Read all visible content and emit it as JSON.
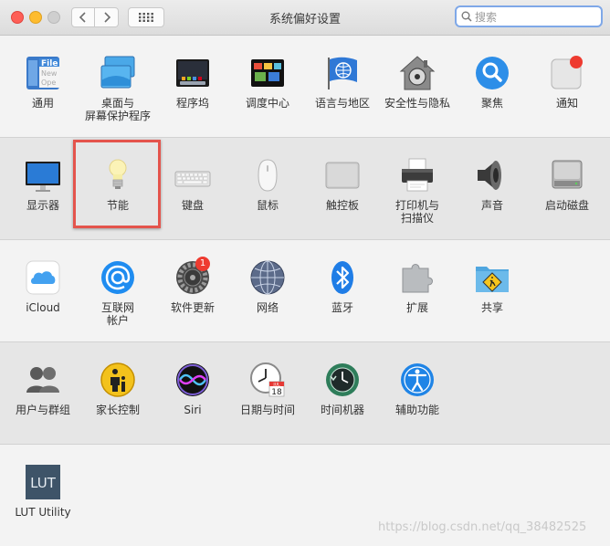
{
  "window": {
    "title": "系统偏好设置"
  },
  "search": {
    "placeholder": "搜索"
  },
  "row1": {
    "general": "通用",
    "desktop": "桌面与\n屏幕保护程序",
    "dock": "程序坞",
    "mission_control": "调度中心",
    "language": "语言与地区",
    "security": "安全性与隐私",
    "spotlight": "聚焦",
    "notifications": "通知",
    "general_icon_text": [
      "File",
      "New",
      "Ope"
    ]
  },
  "row2": {
    "displays": "显示器",
    "energy": "节能",
    "keyboard": "键盘",
    "mouse": "鼠标",
    "trackpad": "触控板",
    "printers": "打印机与\n扫描仪",
    "sound": "声音",
    "startup": "启动磁盘"
  },
  "row3": {
    "icloud": "iCloud",
    "internet_accounts": "互联网\n帐户",
    "software_update": "软件更新",
    "software_update_badge": "1",
    "network": "网络",
    "bluetooth": "蓝牙",
    "extensions": "扩展",
    "sharing": "共享"
  },
  "row4": {
    "users": "用户与群组",
    "parental": "家长控制",
    "siri": "Siri",
    "datetime": "日期与时间",
    "datetime_icon_month": "JUL",
    "datetime_icon_day": "18",
    "timemachine": "时间机器",
    "accessibility": "辅助功能"
  },
  "row5": {
    "lut": "LUT Utility",
    "lut_icon_text": "LUT"
  },
  "watermark": "https://blog.csdn.net/qq_38482525"
}
